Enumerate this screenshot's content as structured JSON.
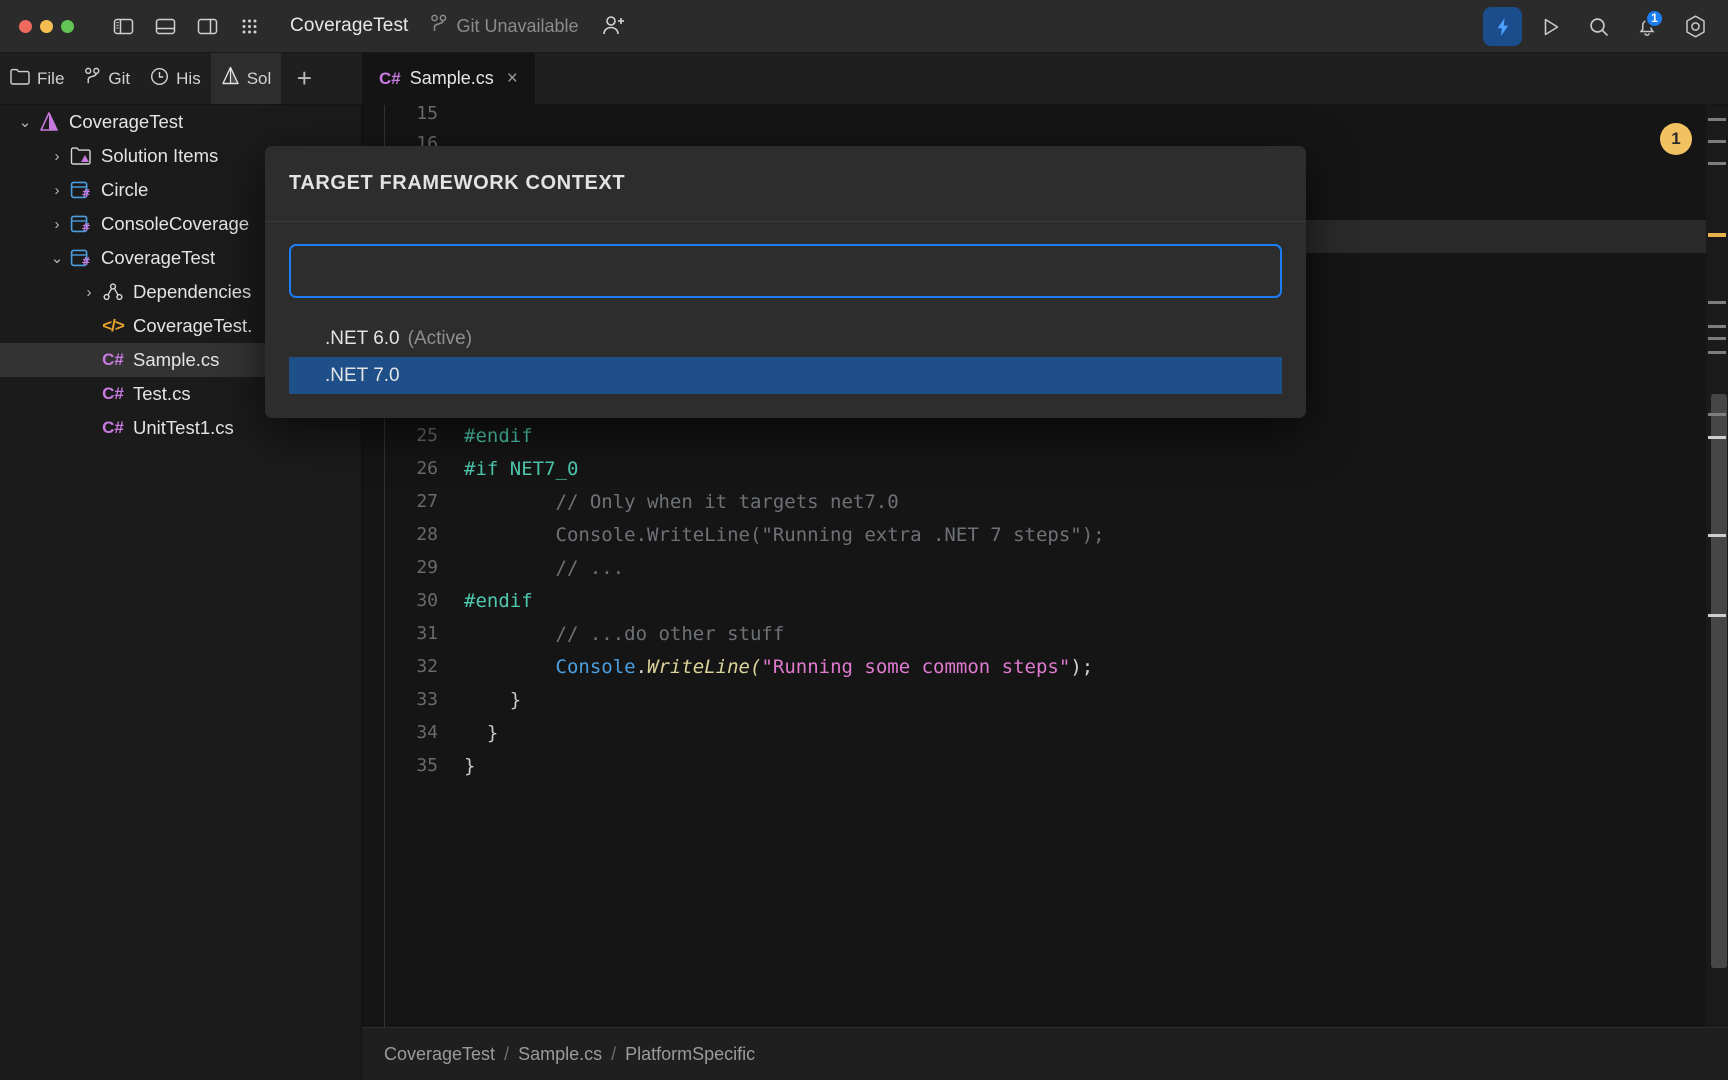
{
  "titlebar": {
    "project_title": "CoverageTest",
    "git_status": "Git Unavailable",
    "icons": {
      "left_panel": "left-panel-icon",
      "bottom_panel": "bottom-panel-icon",
      "right_panel": "right-panel-icon",
      "grid": "grid-icon",
      "git_branch": "git-branch-icon",
      "add_user": "add-user-icon",
      "lightning": "lightning-icon",
      "run": "run-icon",
      "search": "search-icon",
      "notifications": "bell-icon",
      "settings": "gear-icon"
    },
    "notification_count": "1"
  },
  "tool_tabs": [
    {
      "label": "File",
      "icon": "folder-icon",
      "active": false
    },
    {
      "label": "Git",
      "icon": "git-branch-icon",
      "active": false
    },
    {
      "label": "His",
      "icon": "clock-icon",
      "active": false
    },
    {
      "label": "Sol",
      "icon": "solution-icon",
      "active": true
    }
  ],
  "tool_tabs_add": "+",
  "editor_tabs": [
    {
      "badge": "C#",
      "label": "Sample.cs",
      "close": "×"
    }
  ],
  "sidebar": {
    "items": [
      {
        "depth": 0,
        "chevron": "⌄",
        "icon": "solution-icon",
        "label": "CoverageTest",
        "selected": false
      },
      {
        "depth": 1,
        "chevron": "›",
        "icon": "folder-solution-icon",
        "label": "Solution Items",
        "selected": false
      },
      {
        "depth": 1,
        "chevron": "›",
        "icon": "csproj-icon",
        "label": "Circle",
        "selected": false
      },
      {
        "depth": 1,
        "chevron": "›",
        "icon": "csproj-icon",
        "label": "ConsoleCoverage",
        "selected": false
      },
      {
        "depth": 1,
        "chevron": "⌄",
        "icon": "csproj-icon",
        "label": "CoverageTest",
        "selected": false
      },
      {
        "depth": 2,
        "chevron": "›",
        "icon": "dependencies-icon",
        "label": "Dependencies",
        "selected": false
      },
      {
        "depth": 2,
        "chevron": "",
        "icon": "code-file-icon",
        "label": "CoverageTest.",
        "selected": false
      },
      {
        "depth": 2,
        "chevron": "",
        "icon": "csharp-file-icon",
        "label": "Sample.cs",
        "selected": true
      },
      {
        "depth": 2,
        "chevron": "",
        "icon": "csharp-file-icon",
        "label": "Test.cs",
        "selected": false
      },
      {
        "depth": 2,
        "chevron": "",
        "icon": "csharp-file-icon",
        "label": "UnitTest1.cs",
        "selected": false
      }
    ]
  },
  "dialog": {
    "title": "TARGET FRAMEWORK CONTEXT",
    "input_value": "",
    "input_placeholder": "",
    "options": [
      {
        "label": ".NET 6.0",
        "suffix": "(Active)",
        "selected": false
      },
      {
        "label": ".NET 7.0",
        "suffix": "",
        "selected": true
      }
    ]
  },
  "editor": {
    "top_partial_lines": [
      "15",
      "16"
    ],
    "lines": [
      {
        "num": "25",
        "tokens": [
          {
            "t": "#endif",
            "c": "c-pre"
          }
        ]
      },
      {
        "num": "26",
        "tokens": [
          {
            "t": "#if NET7_0",
            "c": "c-pre"
          }
        ]
      },
      {
        "num": "27",
        "tokens": [
          {
            "t": "        // Only when it targets net7.0",
            "c": "c-cmt"
          }
        ]
      },
      {
        "num": "28",
        "tokens": [
          {
            "t": "        Console.WriteLine(\"Running extra .NET 7 steps\");",
            "c": "c-cmt"
          }
        ]
      },
      {
        "num": "29",
        "tokens": [
          {
            "t": "        // ...",
            "c": "c-cmt"
          }
        ]
      },
      {
        "num": "30",
        "tokens": [
          {
            "t": "#endif",
            "c": "c-pre"
          }
        ]
      },
      {
        "num": "31",
        "tokens": [
          {
            "t": "        // ...do other stuff",
            "c": "c-cmt"
          }
        ]
      },
      {
        "num": "32",
        "tokens": [
          {
            "t": "        ",
            "c": "c-plain"
          },
          {
            "t": "Console",
            "c": "c-cls"
          },
          {
            "t": ".",
            "c": "c-pun"
          },
          {
            "t": "WriteLine",
            "c": "c-mth"
          },
          {
            "t": "(",
            "c": "c-mth"
          },
          {
            "t": "\"Running some common steps\"",
            "c": "c-str"
          },
          {
            "t": ");",
            "c": "c-pun"
          }
        ]
      },
      {
        "num": "33",
        "tokens": [
          {
            "t": "    }",
            "c": "c-plain"
          }
        ]
      },
      {
        "num": "34",
        "tokens": [
          {
            "t": "  }",
            "c": "c-plain"
          }
        ]
      },
      {
        "num": "35",
        "tokens": [
          {
            "t": "}",
            "c": "c-plain"
          }
        ]
      }
    ],
    "marker_badge": "1"
  },
  "breadcrumb": {
    "parts": [
      "CoverageTest",
      "Sample.cs",
      "PlatformSpecific"
    ],
    "separator": "/"
  },
  "colors": {
    "accent_blue": "#1b7ef2",
    "selection_blue": "#1f4f89",
    "amber": "#f3c260",
    "preprocessor": "#4ec9b0",
    "string": "#e07ad0",
    "class": "#4a9fe0",
    "method": "#dcd39a",
    "comment": "#6e7277",
    "csharp_badge": "#c97ae0"
  }
}
